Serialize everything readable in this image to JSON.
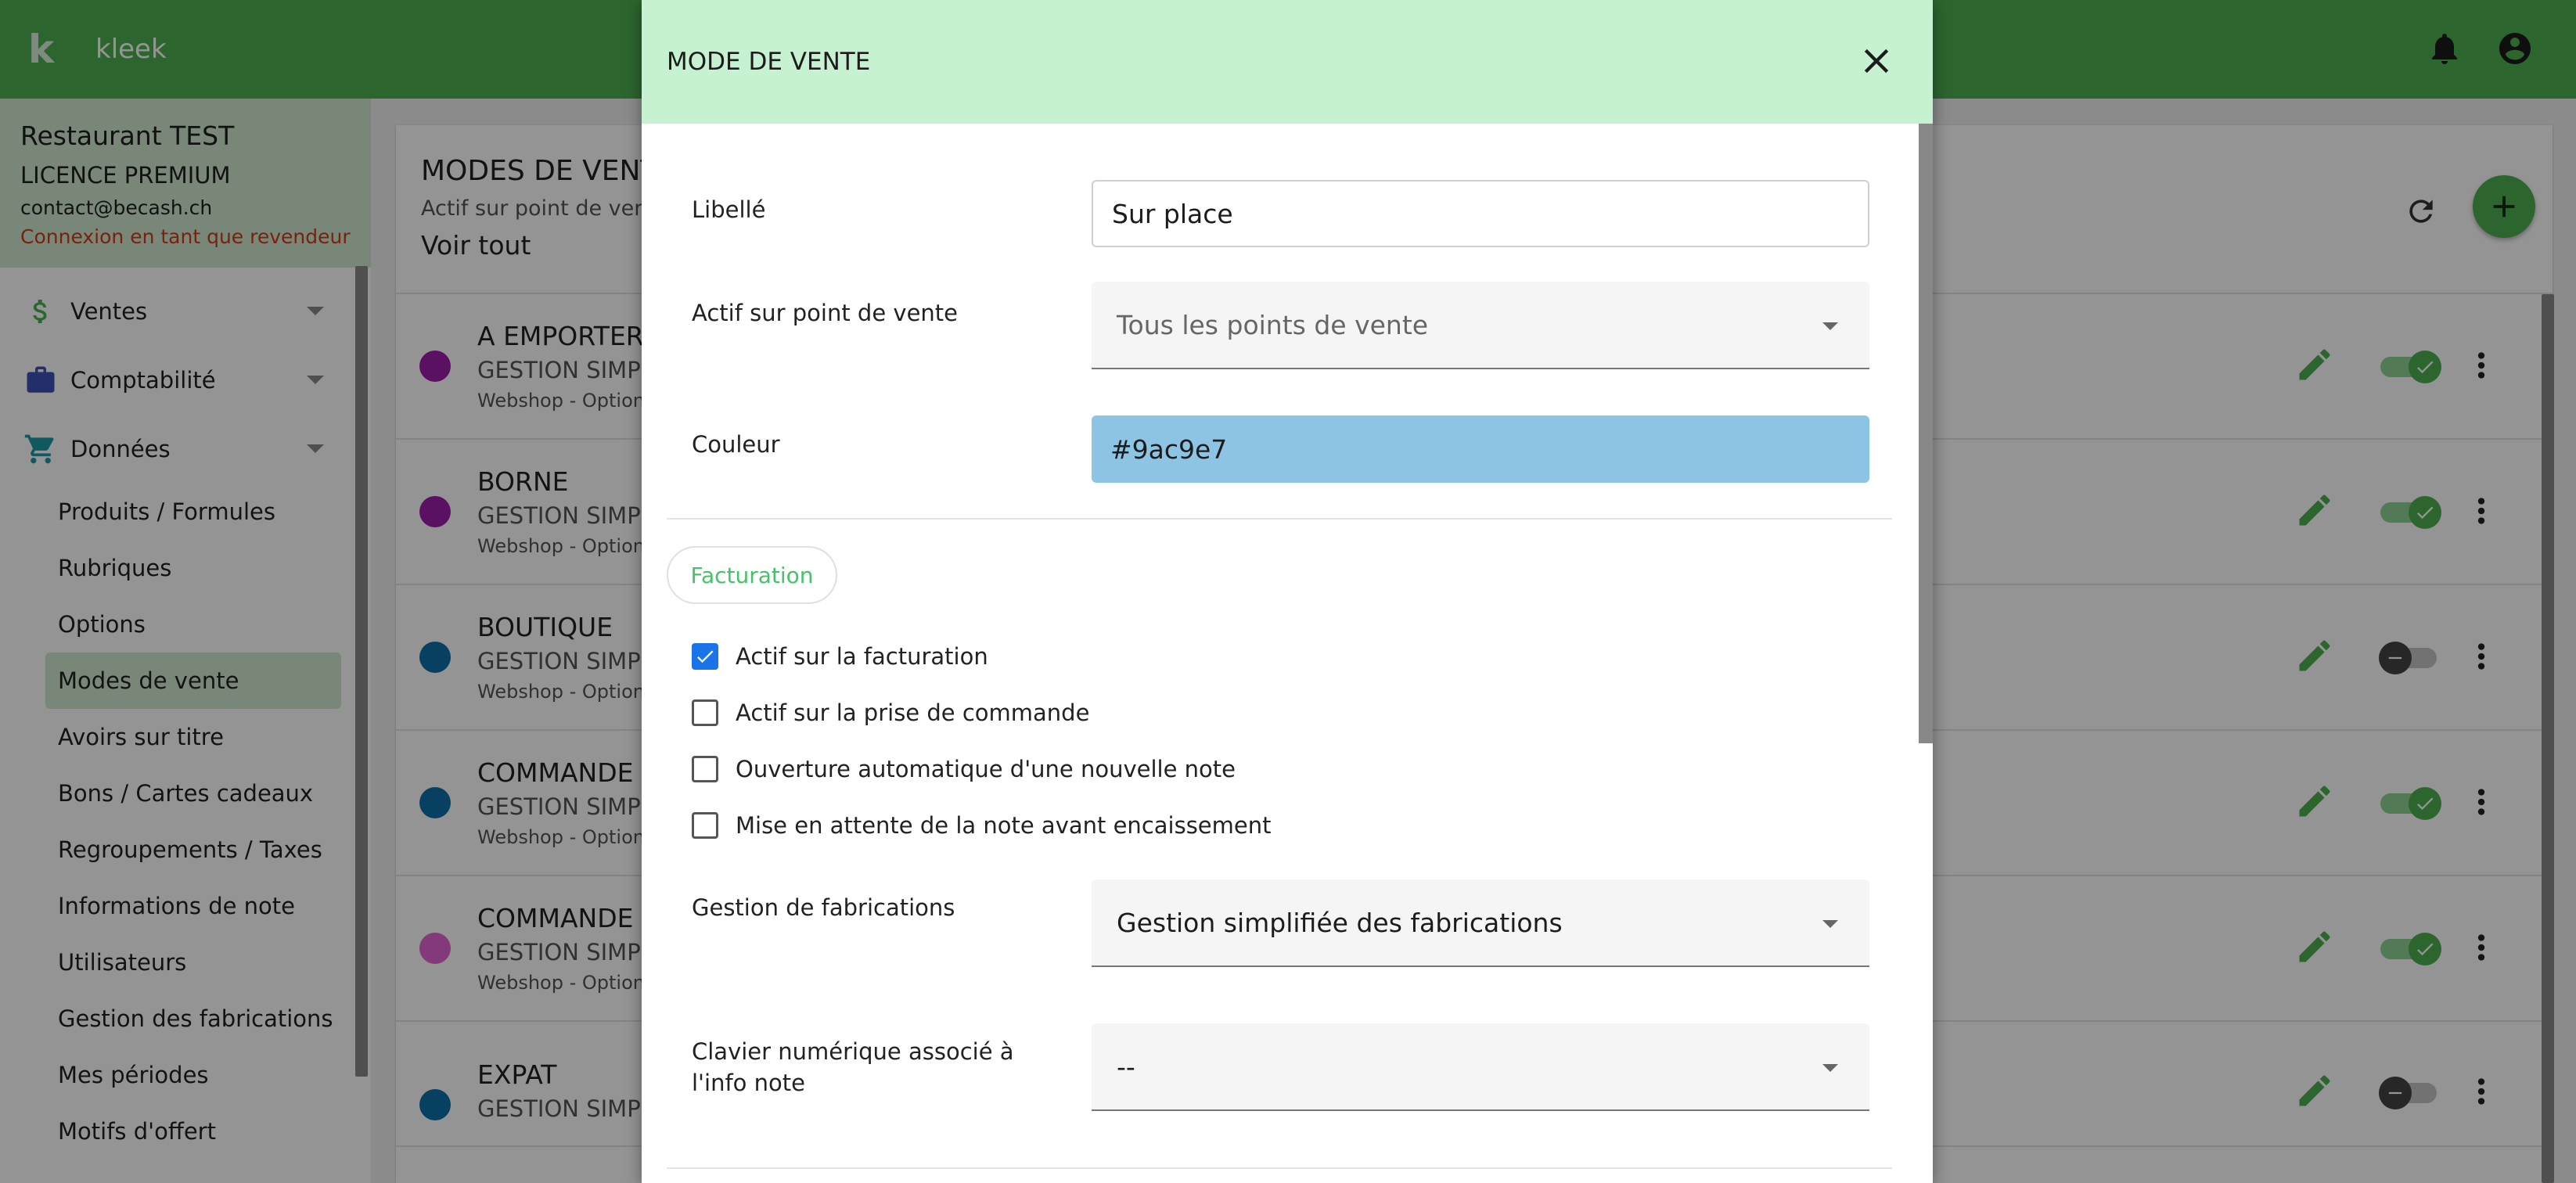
{
  "app": {
    "name": "kleek",
    "logo_letter": "k"
  },
  "topbar": {
    "icons": [
      "bell-icon",
      "account-circle-icon"
    ]
  },
  "account": {
    "restaurant": "Restaurant TEST",
    "licence": "LICENCE PREMIUM",
    "email": "contact@becash.ch",
    "reseller_login": "Connexion en tant que revendeur"
  },
  "sidebar": {
    "groups": [
      {
        "label": "Ventes",
        "icon": "dollar-icon",
        "color": "#4caf50"
      },
      {
        "label": "Comptabilité",
        "icon": "briefcase-icon",
        "color": "#3f51b5"
      },
      {
        "label": "Données",
        "icon": "cart-icon",
        "color": "#1e9aa8"
      }
    ],
    "items": [
      "Produits / Formules",
      "Rubriques",
      "Options",
      "Modes de vente",
      "Avoirs sur titre",
      "Bons / Cartes cadeaux",
      "Regroupements / Taxes",
      "Informations de note",
      "Utilisateurs",
      "Gestion des fabrications",
      "Mes périodes",
      "Motifs d'offert"
    ],
    "active_item": "Modes de vente"
  },
  "main": {
    "title": "MODES DE VENTE",
    "subtitle": "Actif sur point de vente",
    "view_all": "Voir tout",
    "rows": [
      {
        "title": "A EMPORTER",
        "subtitle": "GESTION SIMPLIFIÉE DES FABRICATIONS",
        "meta": "Webshop - Option",
        "color": "#9c1ea8",
        "active": true
      },
      {
        "title": "BORNE",
        "subtitle": "GESTION SIMPLIFIÉE DES FABRICATIONS",
        "meta": "Webshop - Option",
        "color": "#9c1ea8",
        "active": true
      },
      {
        "title": "BOUTIQUE",
        "subtitle": "GESTION SIMPLIFIÉE DES FABRICATIONS",
        "meta": "Webshop - Option",
        "color": "#0e6fa8",
        "active": false
      },
      {
        "title": "COMMANDE À",
        "subtitle": "GESTION SIMPLIFIÉE DES FABRICATIONS",
        "meta": "Webshop - Option",
        "color": "#0e6fa8",
        "active": true
      },
      {
        "title": "COMMANDE C",
        "subtitle": "GESTION SIMPLIFIÉE DES FABRICATIONS",
        "meta": "Webshop - Option",
        "color": "#e065d2",
        "active": true
      },
      {
        "title": "EXPAT",
        "subtitle": "GESTION SIMPLIFIÉE DES FABRICATIONS",
        "meta": "",
        "color": "#0e6fa8",
        "active": false
      }
    ]
  },
  "dialog": {
    "title": "MODE DE VENTE",
    "fields": {
      "libelle_label": "Libellé",
      "libelle_value": "Sur place",
      "pos_label": "Actif sur point de vente",
      "pos_placeholder": "Tous les points de vente",
      "color_label": "Couleur",
      "color_value": "#9ac9e7",
      "fabrication_label": "Gestion de fabrications",
      "fabrication_value": "Gestion simplifiée des fabrications",
      "keypad_label": "Clavier numérique associé à l'info note",
      "keypad_value": "--"
    },
    "section": "Facturation",
    "checkboxes": [
      {
        "label": "Actif sur la facturation",
        "checked": true
      },
      {
        "label": "Actif sur la prise de commande",
        "checked": false
      },
      {
        "label": "Ouverture automatique d'une nouvelle note",
        "checked": false
      },
      {
        "label": "Mise en attente de la note avant encaissement",
        "checked": false
      }
    ]
  },
  "colors": {
    "brand_green": "#4caf50",
    "header_mint": "#c6f2d1",
    "accent_link": "#47c16a",
    "color_swatch_field": "#8ec4e3",
    "checkbox_blue": "#1a73e8"
  }
}
